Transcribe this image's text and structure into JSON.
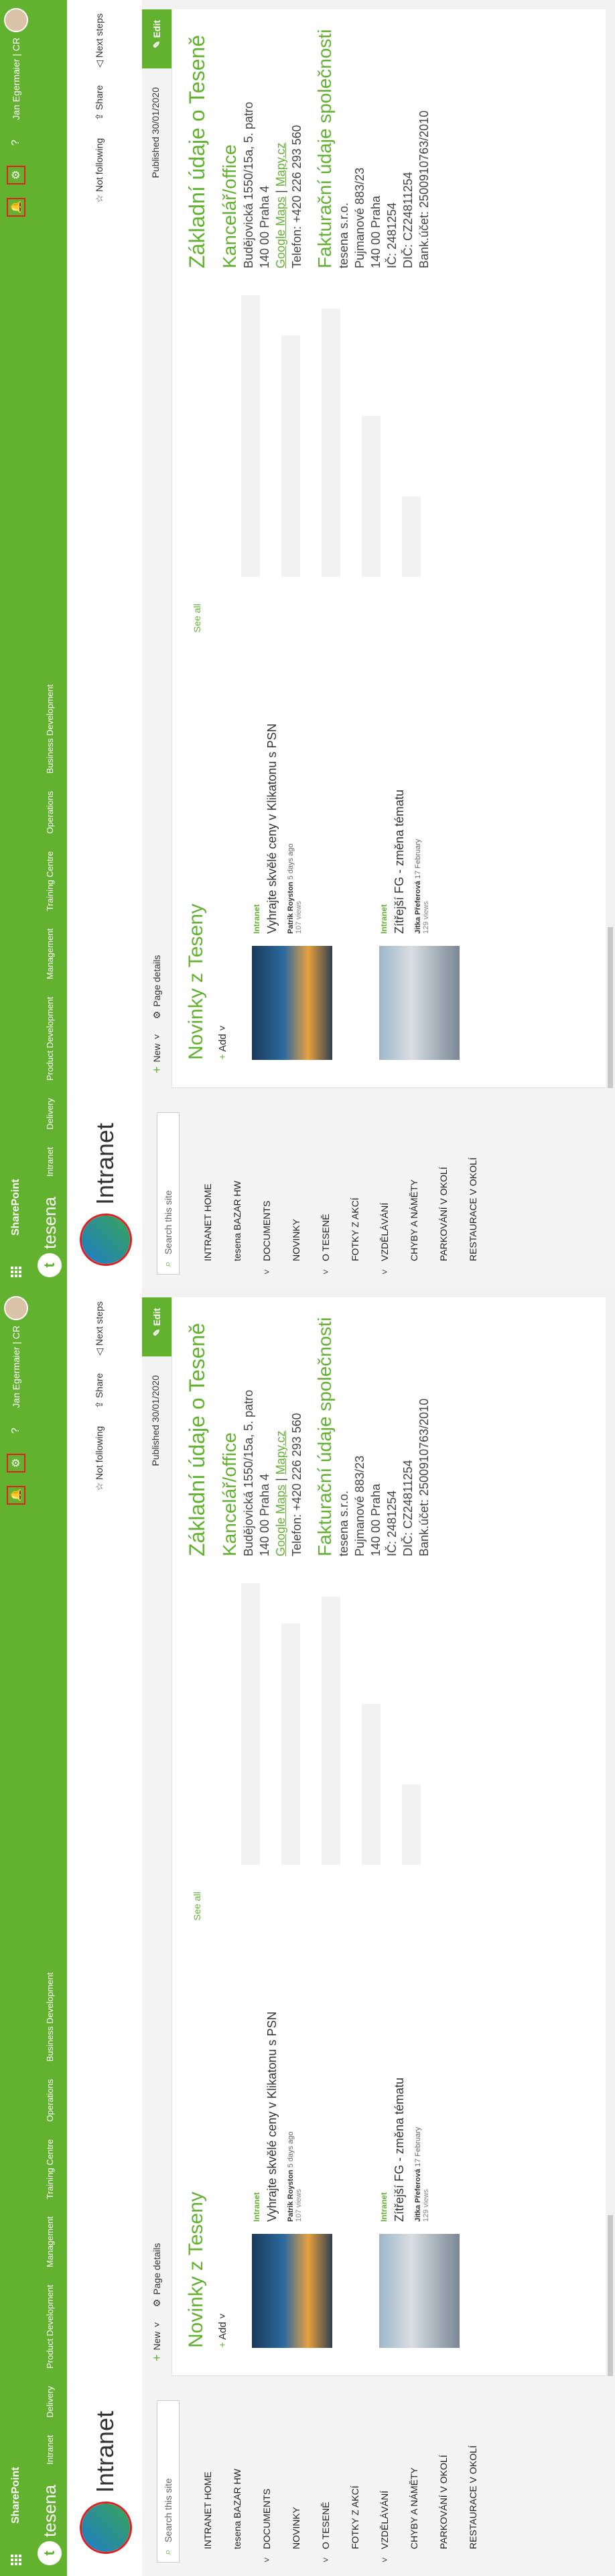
{
  "suite": {
    "app_name": "SharePoint",
    "user_name": "Jan Egermaier | CR",
    "icons": [
      "waffle-icon",
      "bell-icon",
      "settings-icon",
      "help-icon"
    ]
  },
  "site": {
    "brand": "tesena",
    "nav": [
      "Intranet",
      "Delivery",
      "Product Development",
      "Management",
      "Training Centre",
      "Operations",
      "Business Development"
    ],
    "title": "Intranet",
    "actions": {
      "not_following": "Not following",
      "share": "Share",
      "next_steps": "Next steps"
    }
  },
  "leftnav": {
    "search_placeholder": "Search this site",
    "items": [
      {
        "label": "INTRANET HOME",
        "chevron": ""
      },
      {
        "label": "tesena BAZAR HW",
        "chevron": ""
      },
      {
        "label": "DOCUMENTS",
        "chevron": "˅"
      },
      {
        "label": "NOVINKY",
        "chevron": ""
      },
      {
        "label": "O TESENĚ",
        "chevron": "˅"
      },
      {
        "label": "FOTKY Z AKCÍ",
        "chevron": ""
      },
      {
        "label": "VZDĚLÁVÁNÍ",
        "chevron": "˅"
      },
      {
        "label": "CHYBY A NÁMĚTY",
        "chevron": ""
      },
      {
        "label": "PARKOVÁNÍ V OKOLÍ",
        "chevron": ""
      },
      {
        "label": "RESTAURACE V OKOLÍ",
        "chevron": ""
      }
    ]
  },
  "cmdbar": {
    "new": "New",
    "page_details": "Page details",
    "published": "Published 30/01/2020",
    "edit": "Edit"
  },
  "news": {
    "title": "Novinky z Teseny",
    "add": "Add",
    "see_all": "See all",
    "items": [
      {
        "tag": "Intranet",
        "title": "Vyhrajte skvělé ceny v Klikatonu s PSN",
        "author": "Patrik Royston",
        "when": "5 days ago",
        "views": "107 views"
      },
      {
        "tag": "Intranet",
        "title": "Zítřejší FG - změna tématu",
        "author": "Jitka Přeferová",
        "when": "17 February",
        "views": "129 views"
      }
    ]
  },
  "info": {
    "h1": "Základní údaje o Teseně",
    "office_h": "Kancelář/office",
    "addr1": "Budějovická 1550/15a, 5. patro",
    "addr2": "140 00 Praha 4",
    "link_google": "Google Maps",
    "link_sep": " | ",
    "link_mapy": "Mapy.cz",
    "phone": "Telefon: +420 226 293 560",
    "billing_h": "Fakturační údaje společnosti",
    "b1": "tesena s.r.o.",
    "b2": "Pujmanové 883/23",
    "b3": "140 00 Praha",
    "b4": "IČ: 2481254",
    "b5": "DIČ: CZ24811254",
    "b6": "Bank.účet: 2500910763/2010"
  },
  "colors": {
    "accent": "#62b22f",
    "highlight_box": "#e02020"
  }
}
